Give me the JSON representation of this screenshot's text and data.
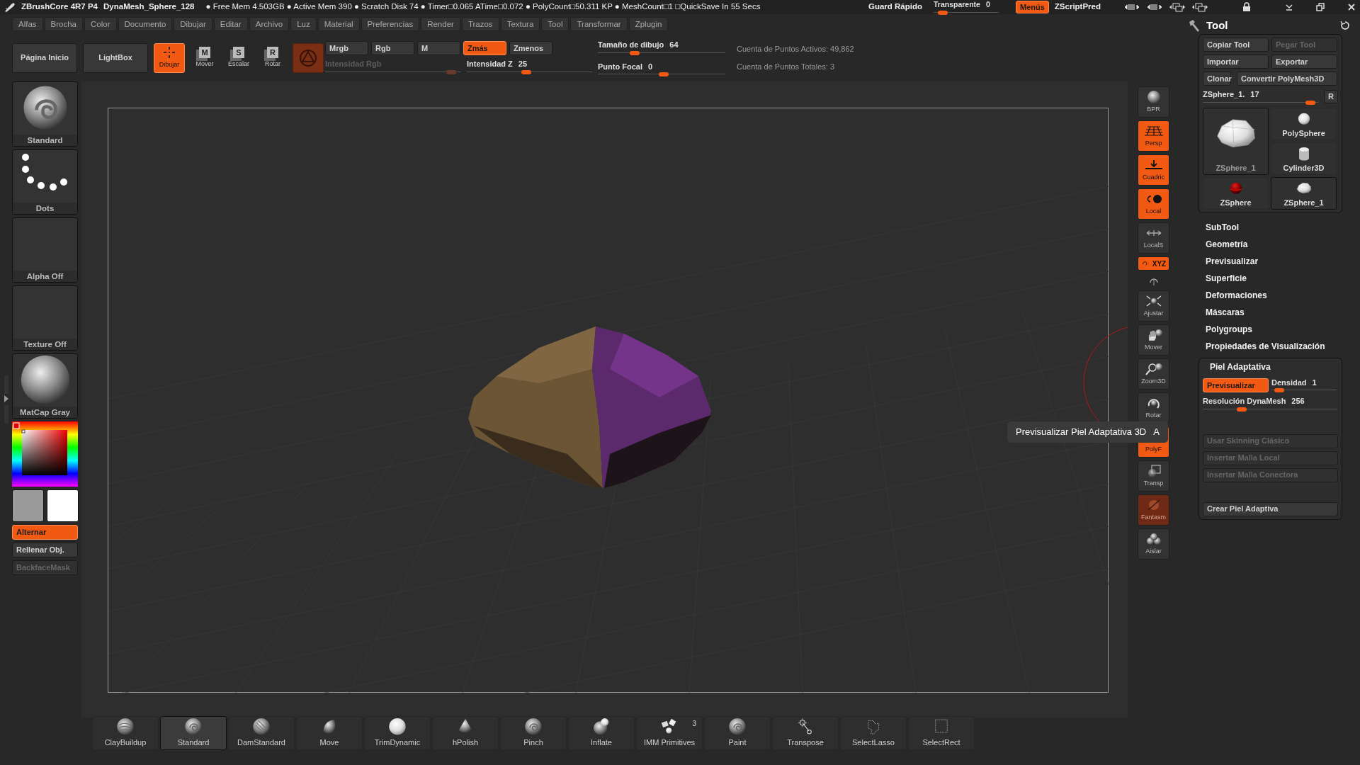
{
  "title_bar": {
    "app_name": "ZBrushCore 4R7 P4",
    "document": "DynaMesh_Sphere_128",
    "status": "● Free Mem 4.503GB ● Active Mem 390 ● Scratch Disk 74 ● Timer□0.065 ATime□0.072 ● PolyCount□50.311 KP ● MeshCount□1 □QuickSave In 55 Secs",
    "quicksave": "Guard Rápido",
    "transparency": {
      "label": "Transparente",
      "value": "0",
      "level": 0.08
    },
    "menus_toggle": {
      "label": "Menús",
      "on": true
    },
    "script": "ZScriptPred"
  },
  "menu_bar": [
    "Alfas",
    "Brocha",
    "Color",
    "Documento",
    "Dibujar",
    "Editar",
    "Archivo",
    "Luz",
    "Material",
    "Preferencias",
    "Render",
    "Trazos",
    "Textura",
    "Tool",
    "Transformar",
    "Zplugin"
  ],
  "shelf": {
    "pages": [
      "Página Inicio",
      "LightBox"
    ],
    "modes": [
      {
        "label": "Dibujar",
        "kind": "draw",
        "selected": true
      },
      {
        "label": "Mover",
        "kind": "letter",
        "glyph": "M",
        "selected": false
      },
      {
        "label": "Escalar",
        "kind": "letter",
        "glyph": "S",
        "selected": false
      },
      {
        "label": "Rotar",
        "kind": "letter",
        "glyph": "R",
        "selected": false
      }
    ],
    "channels": [
      {
        "label": "Mrgb",
        "on": false
      },
      {
        "label": "Rgb",
        "on": false
      },
      {
        "label": "M",
        "on": false
      },
      {
        "label": "Zmás",
        "on": true
      },
      {
        "label": "Zmenos",
        "on": false
      }
    ],
    "intensity_sliders": [
      {
        "label": "Intensidad Rgb",
        "disabled": true,
        "level": 0.96
      },
      {
        "label": "Intensidad Z",
        "value": "25",
        "disabled": false,
        "level": 0.47
      }
    ],
    "draw_sliders": [
      {
        "label": "Tamaño de dibujo",
        "value": "64",
        "level": 0.27
      },
      {
        "label": "Punto Focal",
        "value": "0",
        "level": 0.52
      }
    ],
    "stats": [
      "Cuenta de Puntos Activos: 49,862",
      "Cuenta de Puntos Totales: 3"
    ]
  },
  "left_panel": {
    "tiles": [
      {
        "label": "Standard",
        "kind": "brush"
      },
      {
        "label": "Dots",
        "kind": "stroke"
      },
      {
        "label": "Alpha Off",
        "kind": "empty"
      },
      {
        "label": "Texture Off",
        "kind": "empty"
      },
      {
        "label": "MatCap Gray",
        "kind": "material"
      }
    ],
    "toggles": [
      {
        "label": "Alternar",
        "on": true,
        "disabled": false
      },
      {
        "label": "Rellenar Obj.",
        "on": false,
        "disabled": false
      },
      {
        "label": "BackfaceMask",
        "on": false,
        "disabled": true
      }
    ]
  },
  "viewport": {
    "tooltip": {
      "text": "Previsualizar Piel Adaptativa 3D",
      "hotkey": "A"
    }
  },
  "view_buttons": [
    {
      "label": "BPR",
      "kind": "bpr",
      "on": false,
      "disabled": false
    },
    {
      "label": "Persp",
      "kind": "persp",
      "on": true,
      "disabled": false
    },
    {
      "label": "Cuadric",
      "kind": "floor",
      "on": true,
      "disabled": false
    },
    {
      "label": "Local",
      "kind": "local",
      "on": true,
      "disabled": false
    },
    {
      "label": "LocalS",
      "kind": "locals",
      "on": false,
      "disabled": false
    },
    {
      "label": "XYZ",
      "kind": "xyz",
      "on": true,
      "disabled": false
    },
    {
      "kind": "rotate-y",
      "on": false,
      "disabled": false
    },
    {
      "label": "Ajustar",
      "kind": "frame",
      "on": false,
      "disabled": false
    },
    {
      "label": "Mover",
      "kind": "move",
      "on": false,
      "disabled": false
    },
    {
      "label": "Zoom3D",
      "kind": "zoom",
      "on": false,
      "disabled": false
    },
    {
      "label": "Rotar",
      "kind": "rotate",
      "on": false,
      "disabled": false
    },
    {
      "label": "PolyF",
      "kind": "polyf",
      "on": true,
      "disabled": false
    },
    {
      "label": "Transp",
      "kind": "transp",
      "on": false,
      "disabled": false
    },
    {
      "label": "Fantasm",
      "kind": "ghost",
      "on": true,
      "disabled": true
    },
    {
      "label": "Aislar",
      "kind": "solo",
      "on": false,
      "disabled": false
    }
  ],
  "tool_palette": {
    "title": "Tool",
    "buttons": [
      {
        "label": "Copiar Tool",
        "disabled": false
      },
      {
        "label": "Pegar Tool",
        "disabled": true
      },
      {
        "label": "Importar",
        "disabled": false
      },
      {
        "label": "Exportar",
        "disabled": false
      },
      {
        "label": "Clonar",
        "disabled": false
      },
      {
        "label": "Convertir PolyMesh3D",
        "disabled": false
      }
    ],
    "tool_slider": {
      "label": "ZSphere_1.",
      "value": "17",
      "level": 0.97
    },
    "reset": "R",
    "current_tool": {
      "label": "ZSphere_1",
      "kind": "blob"
    },
    "tools": [
      {
        "label": "PolySphere",
        "kind": "sphere",
        "selected": false
      },
      {
        "label": "Cylinder3D",
        "kind": "cylinder",
        "selected": false
      },
      {
        "label": "ZSphere",
        "kind": "zsphere",
        "selected": false
      },
      {
        "label": "ZSphere_1",
        "kind": "blob",
        "selected": true
      }
    ],
    "sections": [
      "SubTool",
      "Geometría",
      "Previsualizar",
      "Superficie",
      "Deformaciones",
      "Máscaras",
      "Polygroups",
      "Propiedades de Visualización"
    ],
    "adaptive_skin": {
      "title": "Piel Adaptativa",
      "preview": {
        "label": "Previsualizar",
        "on": true
      },
      "sliders": [
        {
          "label": "Densidad",
          "value": "1",
          "level": 0.05
        },
        {
          "label": "Resolución DynaMesh",
          "value": "256",
          "level": 0.27
        }
      ],
      "buttons": [
        {
          "label": "Usar Skinning Clásico",
          "disabled": true
        },
        {
          "label": "Insertar Malla Local",
          "disabled": true
        },
        {
          "label": "Insertar Malla Conectora",
          "disabled": true
        },
        {
          "label": "Crear Piel Adaptiva",
          "disabled": false
        }
      ]
    }
  },
  "bottom_shelf": [
    {
      "label": "ClayBuildup",
      "kind": "clay",
      "selected": false
    },
    {
      "label": "Standard",
      "kind": "swirl",
      "selected": true
    },
    {
      "label": "DamStandard",
      "kind": "dam",
      "selected": false
    },
    {
      "label": "Move",
      "kind": "move",
      "selected": false
    },
    {
      "label": "TrimDynamic",
      "kind": "plain",
      "selected": false
    },
    {
      "label": "hPolish",
      "kind": "cone",
      "selected": false
    },
    {
      "label": "Pinch",
      "kind": "swirl",
      "selected": false
    },
    {
      "label": "Inflate",
      "kind": "inflate",
      "selected": false
    },
    {
      "label": "IMM Primitives",
      "kind": "imm",
      "badge": "3",
      "selected": false
    },
    {
      "label": "Paint",
      "kind": "swirl",
      "selected": false
    },
    {
      "label": "Transpose",
      "kind": "transpose",
      "selected": false
    },
    {
      "label": "SelectLasso",
      "kind": "lasso",
      "selected": false
    },
    {
      "label": "SelectRect",
      "kind": "rect",
      "selected": false
    }
  ]
}
